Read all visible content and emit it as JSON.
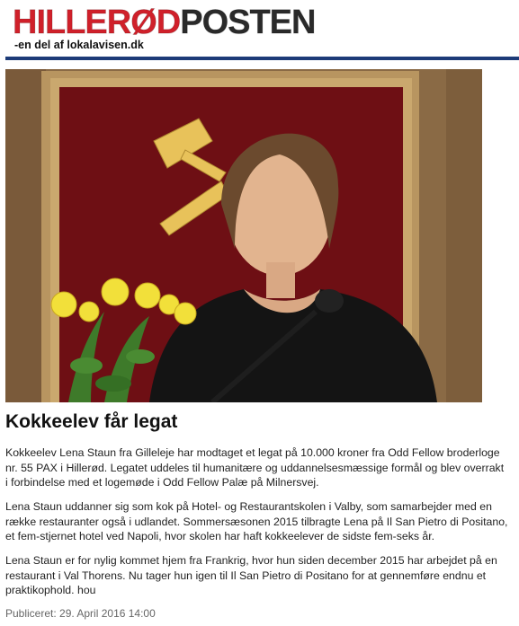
{
  "masthead": {
    "logo_part1": "HILLERØD",
    "logo_part2": "POSTEN",
    "tagline": "-en del af lokalavisen.dk"
  },
  "article": {
    "photo_alt": "Lena Staun",
    "headline": "Kokkeelev får legat",
    "paragraphs": [
      "Kokkeelev Lena Staun fra Gilleleje har modtaget et legat på 10.000 kroner fra Odd Fellow broderloge nr. 55 PAX i Hillerød. Legatet uddeles til humanitære og uddannelsesmæssige formål og blev overrakt i forbindelse med et logemøde i Odd Fellow Palæ på Milnersvej.",
      "Lena Staun uddanner sig som kok på Hotel- og Restaurantskolen i Valby, som samarbejder med en række restauranter også i udlandet. Sommersæsonen 2015 tilbragte Lena på Il San Pietro di Positano, et fem-stjernet hotel ved Napoli, hvor skolen har haft kokkeelever de sidste fem-seks år.",
      "Lena Staun er for nylig kommet hjem fra Frankrig, hvor hun siden december 2015 har arbejdet på en restaurant i Val Thorens. Nu tager hun igen til Il San Pietro di Positano for at gennemføre endnu et praktikophold. hou"
    ],
    "published": "Publiceret: 29. April 2016 14:00"
  },
  "colors": {
    "logo_red": "#d0202a",
    "logo_dark": "#2a2a2a",
    "rule_blue": "#1d3b78"
  }
}
